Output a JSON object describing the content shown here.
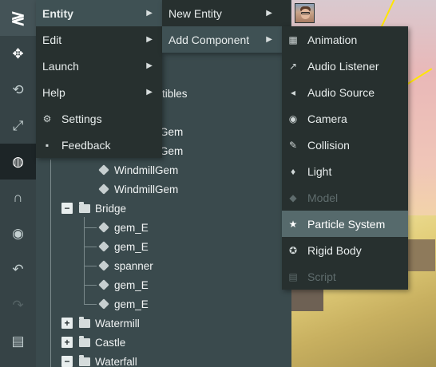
{
  "toolbar": {
    "items": [
      {
        "name": "logo-icon",
        "glyph": "≷"
      },
      {
        "name": "move-icon",
        "glyph": "✥"
      },
      {
        "name": "rotate-icon",
        "glyph": "⟲"
      },
      {
        "name": "scale-icon",
        "glyph": "⤢"
      },
      {
        "name": "world-icon",
        "glyph": "◍"
      },
      {
        "name": "magnet-icon",
        "glyph": "∩"
      },
      {
        "name": "eye-icon",
        "glyph": "◉"
      },
      {
        "name": "undo-icon",
        "glyph": "↶"
      },
      {
        "name": "redo-icon",
        "glyph": "↷"
      },
      {
        "name": "chat-icon",
        "glyph": "▤"
      }
    ]
  },
  "hierarchy": {
    "partial_label": "tibles",
    "partial_gem_1": "Gem",
    "partial_gem_2": "Gem",
    "rows": [
      {
        "label": "WindmillGem",
        "kind": "entity"
      },
      {
        "label": "WindmillGem",
        "kind": "entity"
      },
      {
        "label": "Bridge",
        "kind": "folder",
        "toggle": "−"
      },
      {
        "label": "gem_E",
        "kind": "entity"
      },
      {
        "label": "gem_E",
        "kind": "entity"
      },
      {
        "label": "spanner",
        "kind": "entity"
      },
      {
        "label": "gem_E",
        "kind": "entity"
      },
      {
        "label": "gem_E",
        "kind": "entity"
      },
      {
        "label": "Watermill",
        "kind": "folder",
        "toggle": "+"
      },
      {
        "label": "Castle",
        "kind": "folder",
        "toggle": "+"
      },
      {
        "label": "Waterfall",
        "kind": "folder",
        "toggle": "−"
      }
    ]
  },
  "menu_main": {
    "items": [
      {
        "label": "Entity",
        "arrow": "▶",
        "state": "sel"
      },
      {
        "label": "Edit",
        "arrow": "▶"
      },
      {
        "label": "Launch",
        "arrow": "▶"
      },
      {
        "label": "Help",
        "arrow": "▶"
      },
      {
        "label": "Settings",
        "icon": "⚙"
      },
      {
        "label": "Feedback",
        "icon": "▪"
      }
    ]
  },
  "menu_entity": {
    "items": [
      {
        "label": "New Entity",
        "arrow": "▶"
      },
      {
        "label": "Add Component",
        "arrow": "▶",
        "state": "sel"
      }
    ]
  },
  "menu_components": {
    "items": [
      {
        "label": "Animation",
        "icon": "▦"
      },
      {
        "label": "Audio Listener",
        "icon": "↗"
      },
      {
        "label": "Audio Source",
        "icon": "◂"
      },
      {
        "label": "Camera",
        "icon": "◉"
      },
      {
        "label": "Collision",
        "icon": "🔧"
      },
      {
        "label": "Light",
        "icon": "♦"
      },
      {
        "label": "Model",
        "icon": "◆",
        "state": "disabled"
      },
      {
        "label": "Particle System",
        "icon": "★",
        "state": "hl"
      },
      {
        "label": "Rigid Body",
        "icon": "✪"
      },
      {
        "label": "Script",
        "icon": "▤",
        "state": "disabled"
      }
    ]
  },
  "colors": {
    "menu_bg": "#27302f",
    "selected": "#3f5154",
    "highlight": "#566a6c",
    "panel": "#3a4a4d",
    "toolbar": "#364346"
  }
}
